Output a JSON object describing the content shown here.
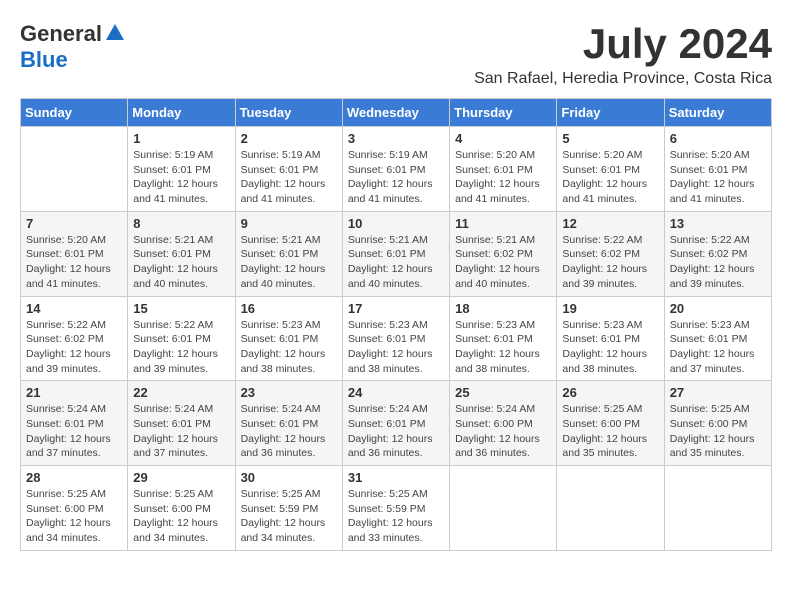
{
  "header": {
    "logo_general": "General",
    "logo_blue": "Blue",
    "month_year": "July 2024",
    "location": "San Rafael, Heredia Province, Costa Rica"
  },
  "calendar": {
    "days_of_week": [
      "Sunday",
      "Monday",
      "Tuesday",
      "Wednesday",
      "Thursday",
      "Friday",
      "Saturday"
    ],
    "weeks": [
      [
        {
          "day": "",
          "info": ""
        },
        {
          "day": "1",
          "info": "Sunrise: 5:19 AM\nSunset: 6:01 PM\nDaylight: 12 hours\nand 41 minutes."
        },
        {
          "day": "2",
          "info": "Sunrise: 5:19 AM\nSunset: 6:01 PM\nDaylight: 12 hours\nand 41 minutes."
        },
        {
          "day": "3",
          "info": "Sunrise: 5:19 AM\nSunset: 6:01 PM\nDaylight: 12 hours\nand 41 minutes."
        },
        {
          "day": "4",
          "info": "Sunrise: 5:20 AM\nSunset: 6:01 PM\nDaylight: 12 hours\nand 41 minutes."
        },
        {
          "day": "5",
          "info": "Sunrise: 5:20 AM\nSunset: 6:01 PM\nDaylight: 12 hours\nand 41 minutes."
        },
        {
          "day": "6",
          "info": "Sunrise: 5:20 AM\nSunset: 6:01 PM\nDaylight: 12 hours\nand 41 minutes."
        }
      ],
      [
        {
          "day": "7",
          "info": "Sunrise: 5:20 AM\nSunset: 6:01 PM\nDaylight: 12 hours\nand 41 minutes."
        },
        {
          "day": "8",
          "info": "Sunrise: 5:21 AM\nSunset: 6:01 PM\nDaylight: 12 hours\nand 40 minutes."
        },
        {
          "day": "9",
          "info": "Sunrise: 5:21 AM\nSunset: 6:01 PM\nDaylight: 12 hours\nand 40 minutes."
        },
        {
          "day": "10",
          "info": "Sunrise: 5:21 AM\nSunset: 6:01 PM\nDaylight: 12 hours\nand 40 minutes."
        },
        {
          "day": "11",
          "info": "Sunrise: 5:21 AM\nSunset: 6:02 PM\nDaylight: 12 hours\nand 40 minutes."
        },
        {
          "day": "12",
          "info": "Sunrise: 5:22 AM\nSunset: 6:02 PM\nDaylight: 12 hours\nand 39 minutes."
        },
        {
          "day": "13",
          "info": "Sunrise: 5:22 AM\nSunset: 6:02 PM\nDaylight: 12 hours\nand 39 minutes."
        }
      ],
      [
        {
          "day": "14",
          "info": "Sunrise: 5:22 AM\nSunset: 6:02 PM\nDaylight: 12 hours\nand 39 minutes."
        },
        {
          "day": "15",
          "info": "Sunrise: 5:22 AM\nSunset: 6:01 PM\nDaylight: 12 hours\nand 39 minutes."
        },
        {
          "day": "16",
          "info": "Sunrise: 5:23 AM\nSunset: 6:01 PM\nDaylight: 12 hours\nand 38 minutes."
        },
        {
          "day": "17",
          "info": "Sunrise: 5:23 AM\nSunset: 6:01 PM\nDaylight: 12 hours\nand 38 minutes."
        },
        {
          "day": "18",
          "info": "Sunrise: 5:23 AM\nSunset: 6:01 PM\nDaylight: 12 hours\nand 38 minutes."
        },
        {
          "day": "19",
          "info": "Sunrise: 5:23 AM\nSunset: 6:01 PM\nDaylight: 12 hours\nand 38 minutes."
        },
        {
          "day": "20",
          "info": "Sunrise: 5:23 AM\nSunset: 6:01 PM\nDaylight: 12 hours\nand 37 minutes."
        }
      ],
      [
        {
          "day": "21",
          "info": "Sunrise: 5:24 AM\nSunset: 6:01 PM\nDaylight: 12 hours\nand 37 minutes."
        },
        {
          "day": "22",
          "info": "Sunrise: 5:24 AM\nSunset: 6:01 PM\nDaylight: 12 hours\nand 37 minutes."
        },
        {
          "day": "23",
          "info": "Sunrise: 5:24 AM\nSunset: 6:01 PM\nDaylight: 12 hours\nand 36 minutes."
        },
        {
          "day": "24",
          "info": "Sunrise: 5:24 AM\nSunset: 6:01 PM\nDaylight: 12 hours\nand 36 minutes."
        },
        {
          "day": "25",
          "info": "Sunrise: 5:24 AM\nSunset: 6:00 PM\nDaylight: 12 hours\nand 36 minutes."
        },
        {
          "day": "26",
          "info": "Sunrise: 5:25 AM\nSunset: 6:00 PM\nDaylight: 12 hours\nand 35 minutes."
        },
        {
          "day": "27",
          "info": "Sunrise: 5:25 AM\nSunset: 6:00 PM\nDaylight: 12 hours\nand 35 minutes."
        }
      ],
      [
        {
          "day": "28",
          "info": "Sunrise: 5:25 AM\nSunset: 6:00 PM\nDaylight: 12 hours\nand 34 minutes."
        },
        {
          "day": "29",
          "info": "Sunrise: 5:25 AM\nSunset: 6:00 PM\nDaylight: 12 hours\nand 34 minutes."
        },
        {
          "day": "30",
          "info": "Sunrise: 5:25 AM\nSunset: 5:59 PM\nDaylight: 12 hours\nand 34 minutes."
        },
        {
          "day": "31",
          "info": "Sunrise: 5:25 AM\nSunset: 5:59 PM\nDaylight: 12 hours\nand 33 minutes."
        },
        {
          "day": "",
          "info": ""
        },
        {
          "day": "",
          "info": ""
        },
        {
          "day": "",
          "info": ""
        }
      ]
    ]
  }
}
